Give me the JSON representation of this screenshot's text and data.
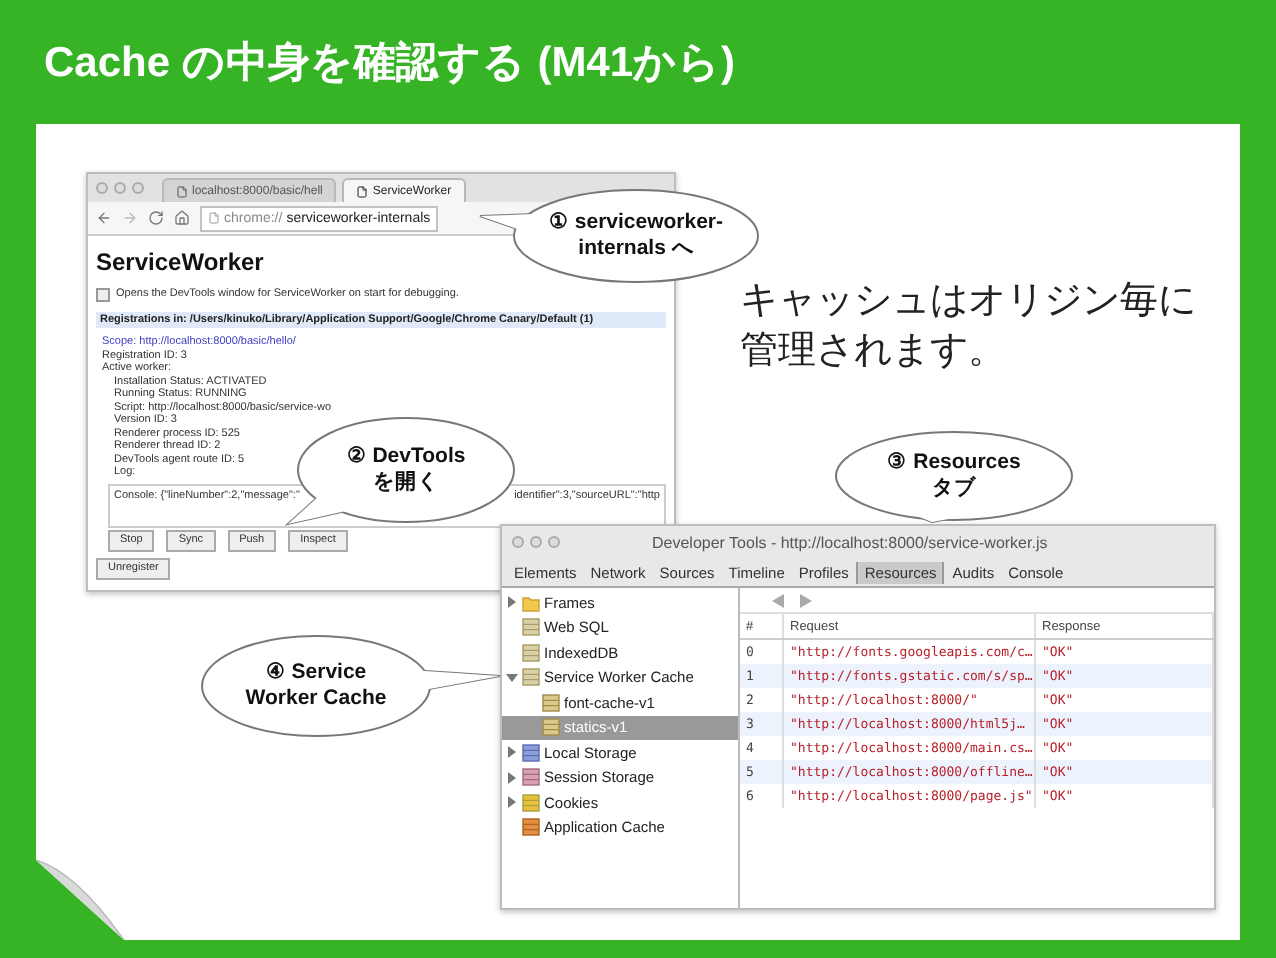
{
  "slide": {
    "title": "Cache の中身を確認する (M41から)"
  },
  "browser": {
    "tabs": [
      {
        "label": "localhost:8000/basic/hell",
        "selected": false
      },
      {
        "label": "ServiceWorker",
        "selected": true
      }
    ],
    "url_scheme": "chrome://",
    "url_path": "serviceworker-internals",
    "heading": "ServiceWorker",
    "debug_option": {
      "label": "Opens the DevTools window for ServiceWorker on start for debugging.",
      "checked": false
    },
    "registrations_header": "Registrations in: /Users/kinuko/Library/Application Support/Google/Chrome Canary/Default (1)",
    "scope_link": "Scope: http://localhost:8000/basic/hello/",
    "details": [
      {
        "text": "Registration ID: 3"
      },
      {
        "text": "Active worker:",
        "children": [
          {
            "text": "Installation Status: ACTIVATED"
          },
          {
            "text": "Running Status: RUNNING"
          },
          {
            "text": "Script: http://localhost:8000/basic/service-wo"
          },
          {
            "text": "Version ID: 3"
          },
          {
            "text": "Renderer process ID: 525"
          },
          {
            "text": "Renderer thread ID: 2"
          },
          {
            "text": "DevTools agent route ID: 5"
          },
          {
            "text": "Log:"
          }
        ]
      }
    ],
    "log": [
      "Console: {\"lineNumber\":2,\"message\":\"",
      "identifier\":3,\"sourceURL\":\"http"
    ],
    "buttons": [
      "Stop",
      "Sync",
      "Push",
      "Inspect"
    ],
    "unregister": "Unregister"
  },
  "note": {
    "lines": [
      "キャッシュはオリジン毎に",
      "管理されます。"
    ]
  },
  "devtools": {
    "title": "Developer Tools - http://localhost:8000/service-worker.js",
    "tabs": [
      {
        "label": "Elements",
        "selected": false
      },
      {
        "label": "Network",
        "selected": false
      },
      {
        "label": "Sources",
        "selected": false
      },
      {
        "label": "Timeline",
        "selected": false
      },
      {
        "label": "Profiles",
        "selected": false
      },
      {
        "label": "Resources",
        "selected": true
      },
      {
        "label": "Audits",
        "selected": false
      },
      {
        "label": "Console",
        "selected": false
      }
    ],
    "sidebar": [
      {
        "label": "Frames",
        "kind": "folder",
        "expanded": false,
        "selected": false
      },
      {
        "label": "Web SQL",
        "kind": "database",
        "selected": false
      },
      {
        "label": "IndexedDB",
        "kind": "database",
        "selected": false
      },
      {
        "label": "Service Worker Cache",
        "kind": "database",
        "expanded": true,
        "selected": false,
        "children": [
          {
            "label": "font-cache-v1",
            "kind": "table",
            "selected": false
          },
          {
            "label": "statics-v1",
            "kind": "table",
            "selected": true
          }
        ]
      },
      {
        "label": "Local Storage",
        "kind": "storage",
        "expanded": false,
        "selected": false
      },
      {
        "label": "Session Storage",
        "kind": "session",
        "expanded": false,
        "selected": false
      },
      {
        "label": "Cookies",
        "kind": "cookie",
        "expanded": false,
        "selected": false
      },
      {
        "label": "Application Cache",
        "kind": "appcache",
        "selected": false
      }
    ],
    "table": {
      "columns": [
        "#",
        "Request",
        "Response"
      ],
      "rows": [
        [
          "0",
          "\"http://fonts.googleapis.com/c…",
          "\"OK\""
        ],
        [
          "1",
          "\"http://fonts.gstatic.com/s/sp…",
          "\"OK\""
        ],
        [
          "2",
          "\"http://localhost:8000/\"",
          "\"OK\""
        ],
        [
          "3",
          "\"http://localhost:8000/html5j…",
          "\"OK\""
        ],
        [
          "4",
          "\"http://localhost:8000/main.cs…",
          "\"OK\""
        ],
        [
          "5",
          "\"http://localhost:8000/offline…",
          "\"OK\""
        ],
        [
          "6",
          "\"http://localhost:8000/page.js\"",
          "\"OK\""
        ]
      ]
    }
  },
  "callouts": [
    {
      "lines": [
        "① serviceworker-",
        "internals へ"
      ]
    },
    {
      "lines": [
        "② DevTools",
        "を開く"
      ]
    },
    {
      "lines": [
        "③ Resources",
        "タブ"
      ]
    },
    {
      "lines": [
        "④ Service",
        "Worker Cache"
      ]
    }
  ]
}
